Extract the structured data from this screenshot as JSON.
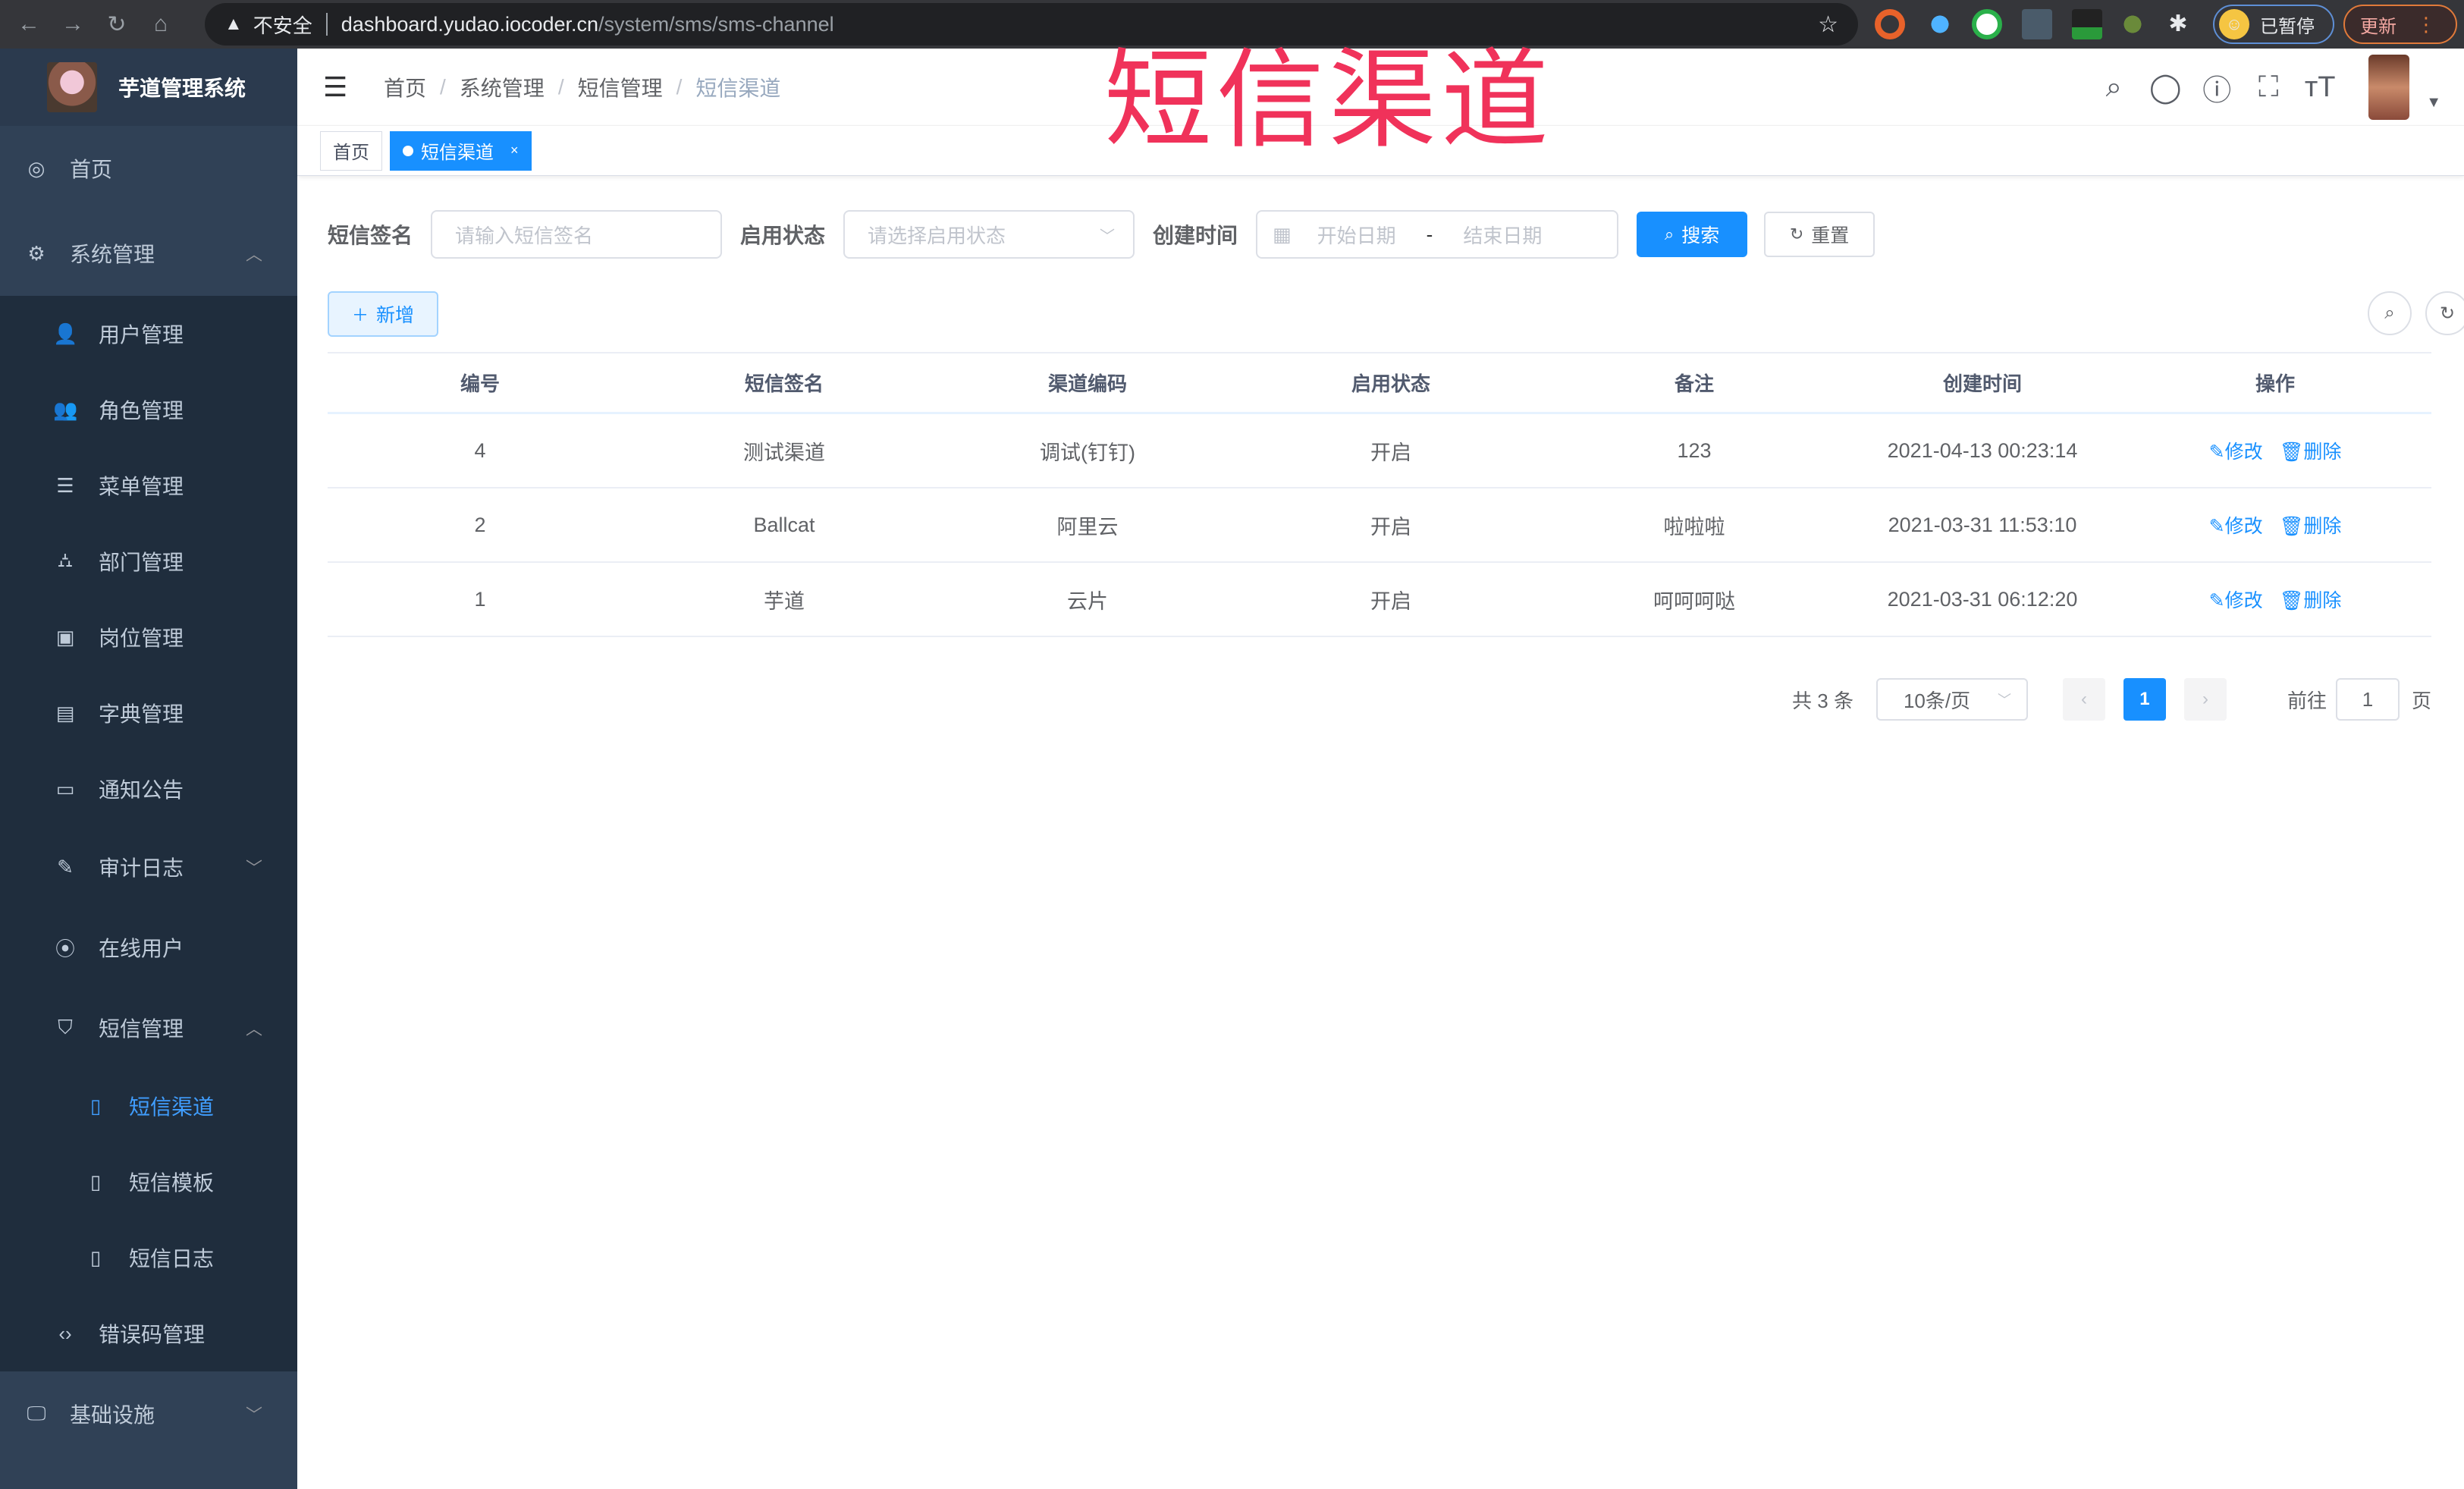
{
  "browser": {
    "security_label": "不安全",
    "url_host": "dashboard.yudao.iocoder.cn",
    "url_path": "/system/sms/sms-channel",
    "profile_label": "已暂停",
    "update_label": "更新"
  },
  "overlay_title": "短信渠道",
  "sidebar": {
    "app_title": "芋道管理系统",
    "items": [
      {
        "label": "首页",
        "icon": "dashboard-icon"
      },
      {
        "label": "系统管理",
        "icon": "gear-icon",
        "expanded": true
      },
      {
        "label": "用户管理",
        "icon": "user-icon"
      },
      {
        "label": "角色管理",
        "icon": "peoples-icon"
      },
      {
        "label": "菜单管理",
        "icon": "tree-table-icon"
      },
      {
        "label": "部门管理",
        "icon": "tree-icon"
      },
      {
        "label": "岗位管理",
        "icon": "post-icon"
      },
      {
        "label": "字典管理",
        "icon": "dict-icon"
      },
      {
        "label": "通知公告",
        "icon": "message-icon"
      },
      {
        "label": "审计日志",
        "icon": "log-icon",
        "expanded": false
      },
      {
        "label": "在线用户",
        "icon": "online-icon"
      },
      {
        "label": "短信管理",
        "icon": "validCode-icon",
        "expanded": true
      },
      {
        "label": "短信渠道",
        "icon": "phone-icon",
        "active": true
      },
      {
        "label": "短信模板",
        "icon": "phone-icon"
      },
      {
        "label": "短信日志",
        "icon": "phone-icon"
      },
      {
        "label": "错误码管理",
        "icon": "code-icon"
      },
      {
        "label": "基础设施",
        "icon": "monitor-icon",
        "expanded": false
      }
    ]
  },
  "navbar": {
    "breadcrumb": [
      "首页",
      "系统管理",
      "短信管理",
      "短信渠道"
    ]
  },
  "tags": [
    {
      "label": "首页",
      "active": false
    },
    {
      "label": "短信渠道",
      "active": true
    }
  ],
  "filter": {
    "signature_label": "短信签名",
    "signature_placeholder": "请输入短信签名",
    "status_label": "启用状态",
    "status_placeholder": "请选择启用状态",
    "time_label": "创建时间",
    "start_placeholder": "开始日期",
    "range_separator": "-",
    "end_placeholder": "结束日期",
    "search_label": "搜索",
    "reset_label": "重置"
  },
  "toolbar": {
    "add_label": "新增"
  },
  "table": {
    "columns": [
      "编号",
      "短信签名",
      "渠道编码",
      "启用状态",
      "备注",
      "创建时间",
      "操作"
    ],
    "rows": [
      {
        "id": "4",
        "signature": "测试渠道",
        "code": "调试(钉钉)",
        "status": "开启",
        "remark": "123",
        "created": "2021-04-13 00:23:14"
      },
      {
        "id": "2",
        "signature": "Ballcat",
        "code": "阿里云",
        "status": "开启",
        "remark": "啦啦啦",
        "created": "2021-03-31 11:53:10"
      },
      {
        "id": "1",
        "signature": "芋道",
        "code": "云片",
        "status": "开启",
        "remark": "呵呵呵哒",
        "created": "2021-03-31 06:12:20"
      }
    ],
    "edit_label": "修改",
    "delete_label": "删除"
  },
  "pagination": {
    "total_text": "共 3 条",
    "page_size": "10条/页",
    "current_page": "1",
    "goto_label": "前往",
    "goto_value": "1",
    "page_suffix": "页"
  }
}
